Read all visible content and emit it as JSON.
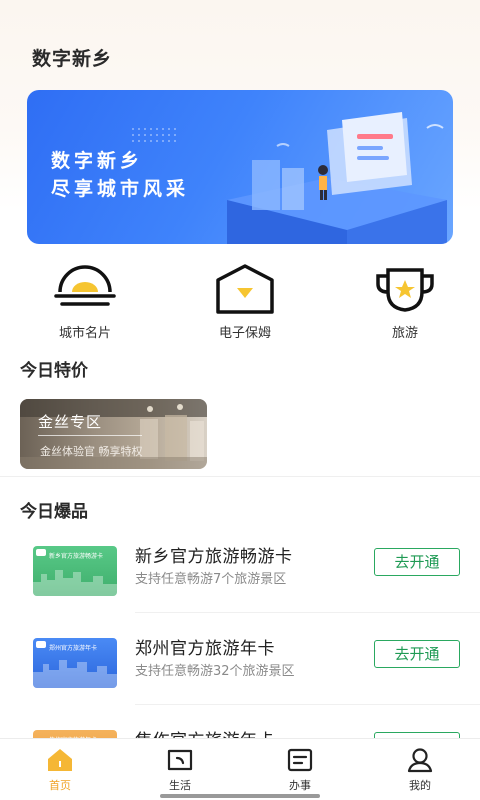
{
  "header": {
    "title": "数字新乡"
  },
  "banner": {
    "line1": "数字新乡",
    "line2": "尽享城市风采"
  },
  "quick_links": [
    {
      "label": "城市名片",
      "icon": "sunrise-icon"
    },
    {
      "label": "电子保姆",
      "icon": "home-heart-icon"
    },
    {
      "label": "旅游",
      "icon": "trophy-star-icon"
    }
  ],
  "today_special": {
    "title": "今日特价",
    "card": {
      "title": "金丝专区",
      "subtitle": "金丝体验官   畅享特权"
    }
  },
  "today_hot": {
    "title": "今日爆品",
    "items": [
      {
        "name": "新乡官方旅游畅游卡",
        "desc": "支持任意畅游7个旅游景区",
        "button": "去开通",
        "thumb_text": "新乡官方旅游畅游卡",
        "thumb_color": "#4fbf7a"
      },
      {
        "name": "郑州官方旅游年卡",
        "desc": "支持任意畅游32个旅游景区",
        "button": "去开通",
        "thumb_text": "郑州官方旅游年卡",
        "thumb_color": "#3a7ef0"
      },
      {
        "name": "焦作官方旅游年卡",
        "desc": "",
        "button": "去开通",
        "thumb_text": "焦作官方旅游年卡",
        "thumb_color": "#f0a040"
      }
    ]
  },
  "tabbar": {
    "tabs": [
      {
        "label": "首页",
        "icon": "home-icon",
        "active": true
      },
      {
        "label": "生活",
        "icon": "life-icon",
        "active": false
      },
      {
        "label": "办事",
        "icon": "affairs-icon",
        "active": false
      },
      {
        "label": "我的",
        "icon": "profile-icon",
        "active": false
      }
    ]
  },
  "colors": {
    "accent_green": "#1f9a54",
    "tab_active": "#f0a428",
    "banner_blue": "#3f83fb"
  }
}
